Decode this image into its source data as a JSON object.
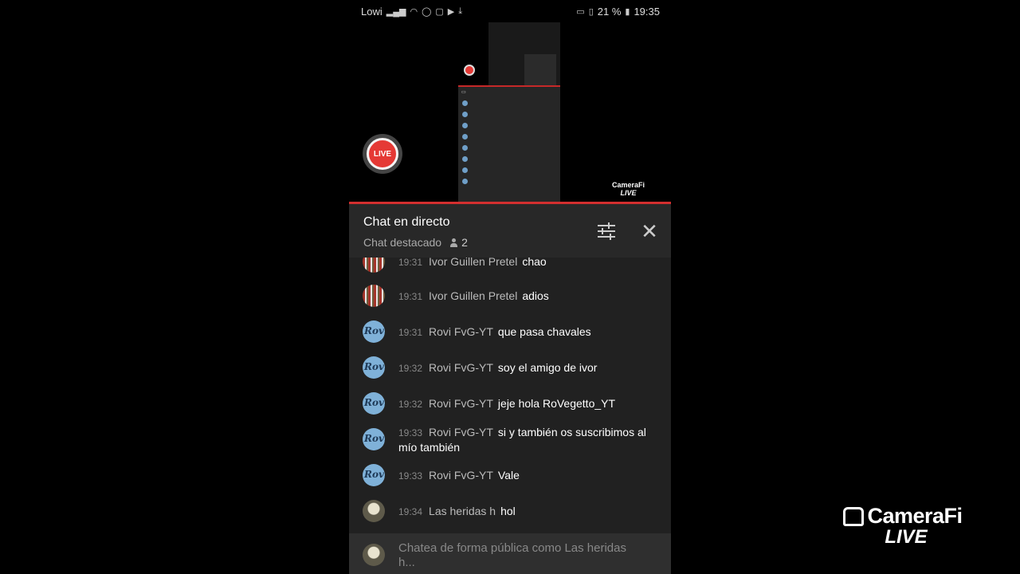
{
  "status_bar": {
    "carrier": "Lowi",
    "battery": "21 %",
    "time": "19:35"
  },
  "preview": {
    "live_label": "LIVE",
    "watermark_brand": "CameraFi",
    "watermark_sub": "LIVE"
  },
  "chat": {
    "title": "Chat en directo",
    "subtitle": "Chat destacado",
    "viewers": "2",
    "messages": [
      {
        "time": "19:31",
        "author": "Ivor Guillen Pretel",
        "text": "chao",
        "avatar": "ivor"
      },
      {
        "time": "19:31",
        "author": "Ivor Guillen Pretel",
        "text": "adios",
        "avatar": "ivor"
      },
      {
        "time": "19:31",
        "author": "Rovi FvG-YT",
        "text": "que pasa chavales",
        "avatar": "rovi"
      },
      {
        "time": "19:32",
        "author": "Rovi FvG-YT",
        "text": "soy el amigo de ivor",
        "avatar": "rovi"
      },
      {
        "time": "19:32",
        "author": "Rovi FvG-YT",
        "text": "jeje hola RoVegetto_YT",
        "avatar": "rovi"
      },
      {
        "time": "19:33",
        "author": "Rovi FvG-YT",
        "text": "si y también os suscribimos al mío también",
        "avatar": "rovi"
      },
      {
        "time": "19:33",
        "author": "Rovi FvG-YT",
        "text": "Vale",
        "avatar": "rovi"
      },
      {
        "time": "19:34",
        "author": "Las heridas h",
        "text": "hol",
        "avatar": "heridas"
      }
    ],
    "input_placeholder": "Chatea de forma pública como Las heridas h..."
  },
  "watermark": {
    "brand": "CameraFi",
    "sub": "LIVE"
  }
}
